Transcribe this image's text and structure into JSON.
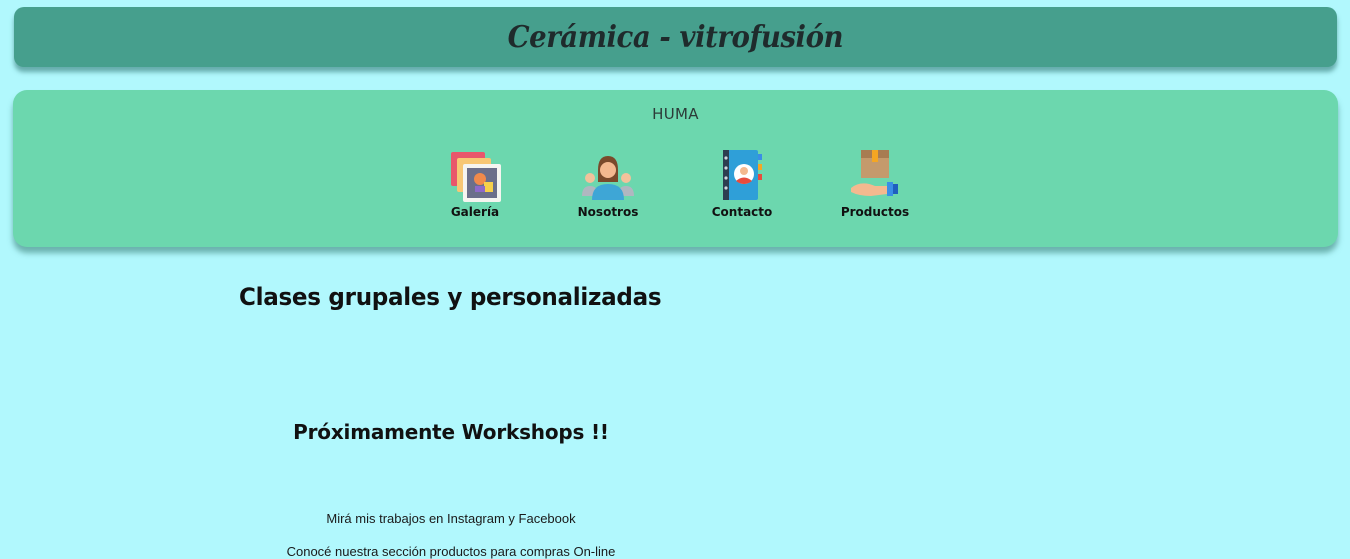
{
  "header": {
    "title": "Cerámica - vitrofusión"
  },
  "nav": {
    "brand": "HUMA",
    "items": [
      {
        "label": "Galería",
        "icon": "gallery-icon"
      },
      {
        "label": "Nosotros",
        "icon": "people-group-icon"
      },
      {
        "label": "Contacto",
        "icon": "address-book-icon"
      },
      {
        "label": "Productos",
        "icon": "hand-package-icon"
      }
    ]
  },
  "main": {
    "heading": "Clases grupales y personalizadas",
    "subheading": "Próximamente Workshops !!",
    "lines": [
      "Mirá mis trabajos en Instagram y Facebook",
      "Conocé nuestra sección productos para compras On-line"
    ]
  },
  "colors": {
    "page_background": "#b1f8fd",
    "header_background": "#469f8d",
    "nav_background": "#6cd7ae"
  }
}
